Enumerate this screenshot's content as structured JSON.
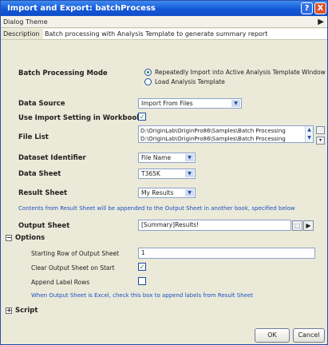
{
  "window": {
    "title": "Import and Export: batchProcess",
    "help_icon": "?",
    "close_icon": "X"
  },
  "theme": {
    "label": "Dialog Theme",
    "arrow_icon": "right-arrow-icon"
  },
  "description": {
    "label": "Description",
    "value": "Batch processing with Analysis Template to generate summary report"
  },
  "form": {
    "batch_mode": {
      "label": "Batch Processing Mode",
      "options": [
        {
          "label": "Repeatedly Import into Active Analysis Template Window",
          "selected": true
        },
        {
          "label": "Load Analysis Template",
          "selected": false
        }
      ]
    },
    "data_source": {
      "label": "Data Source",
      "value": "Import From Files"
    },
    "use_import_setting": {
      "label": "Use Import Setting in Workbook",
      "checked": true
    },
    "file_list": {
      "label": "File List",
      "lines": [
        "D:\\OriginLab\\OriginPro86\\Samples\\Batch Processing",
        "D:\\OriginLab\\OriginPro86\\Samples\\Batch Processing"
      ]
    },
    "dataset_identifier": {
      "label": "Dataset Identifier",
      "value": "File Name"
    },
    "data_sheet": {
      "label": "Data Sheet",
      "value": "T365K"
    },
    "result_sheet": {
      "label": "Result Sheet",
      "value": "My Results"
    },
    "result_note": "Contents from Result Sheet will be appended to the Output Sheet in another book, specified below",
    "output_sheet": {
      "label": "Output Sheet",
      "value": "[Summary]Results!"
    },
    "options": {
      "label": "Options",
      "toggle": "−",
      "starting_row": {
        "label": "Starting Row of Output Sheet",
        "value": "1"
      },
      "clear_output": {
        "label": "Clear Output Sheet on Start",
        "checked": true
      },
      "append_label": {
        "label": "Append Label Rows",
        "checked": false
      },
      "note": "When Output Sheet is Excel, check this box to append labels from Result Sheet"
    },
    "script": {
      "label": "Script",
      "toggle": "+"
    }
  },
  "buttons": {
    "ok": "OK",
    "cancel": "Cancel"
  },
  "colors": {
    "title_bar": "#1458d8",
    "note_text": "#1752c4",
    "check_mark": "#1d8a1d"
  }
}
